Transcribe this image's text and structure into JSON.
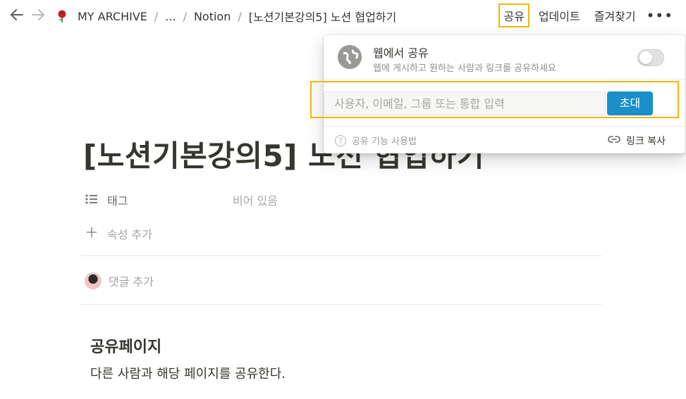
{
  "topbar": {
    "back_icon": "arrow-left-icon",
    "forward_icon": "arrow-right-icon",
    "breadcrumb": {
      "workspace": "MY ARCHIVE",
      "ellipsis": "...",
      "parent": "Notion",
      "current": "[노션기본강의5] 노션 협업하기"
    },
    "actions": {
      "share": "공유",
      "updates": "업데이트",
      "favorite": "즐겨찾기",
      "more": "•••"
    }
  },
  "page": {
    "title": "[노션기본강의5] 노션 협업하기",
    "properties": [
      {
        "label": "태그",
        "value": "비어 있음",
        "icon": "list-icon"
      }
    ],
    "add_property": "속성 추가",
    "add_comment": "댓글 추가",
    "heading": "공유페이지",
    "paragraph": "다른 사람과 해당 페이지를 공유한다."
  },
  "share_popup": {
    "web_share_title": "웹에서 공유",
    "web_share_subtitle": "웹에 게시하고 원하는 사람과 링크를 공유하세요",
    "web_share_enabled": false,
    "invite_placeholder": "사용자, 이메일, 그룹 또는 통합 입력",
    "invite_button": "초대",
    "help_text": "공유 기능 사용법",
    "copy_link": "링크 복사"
  },
  "colors": {
    "highlight": "#f5b400",
    "invite_button": "#1a8fc9",
    "text": "#37352f"
  }
}
